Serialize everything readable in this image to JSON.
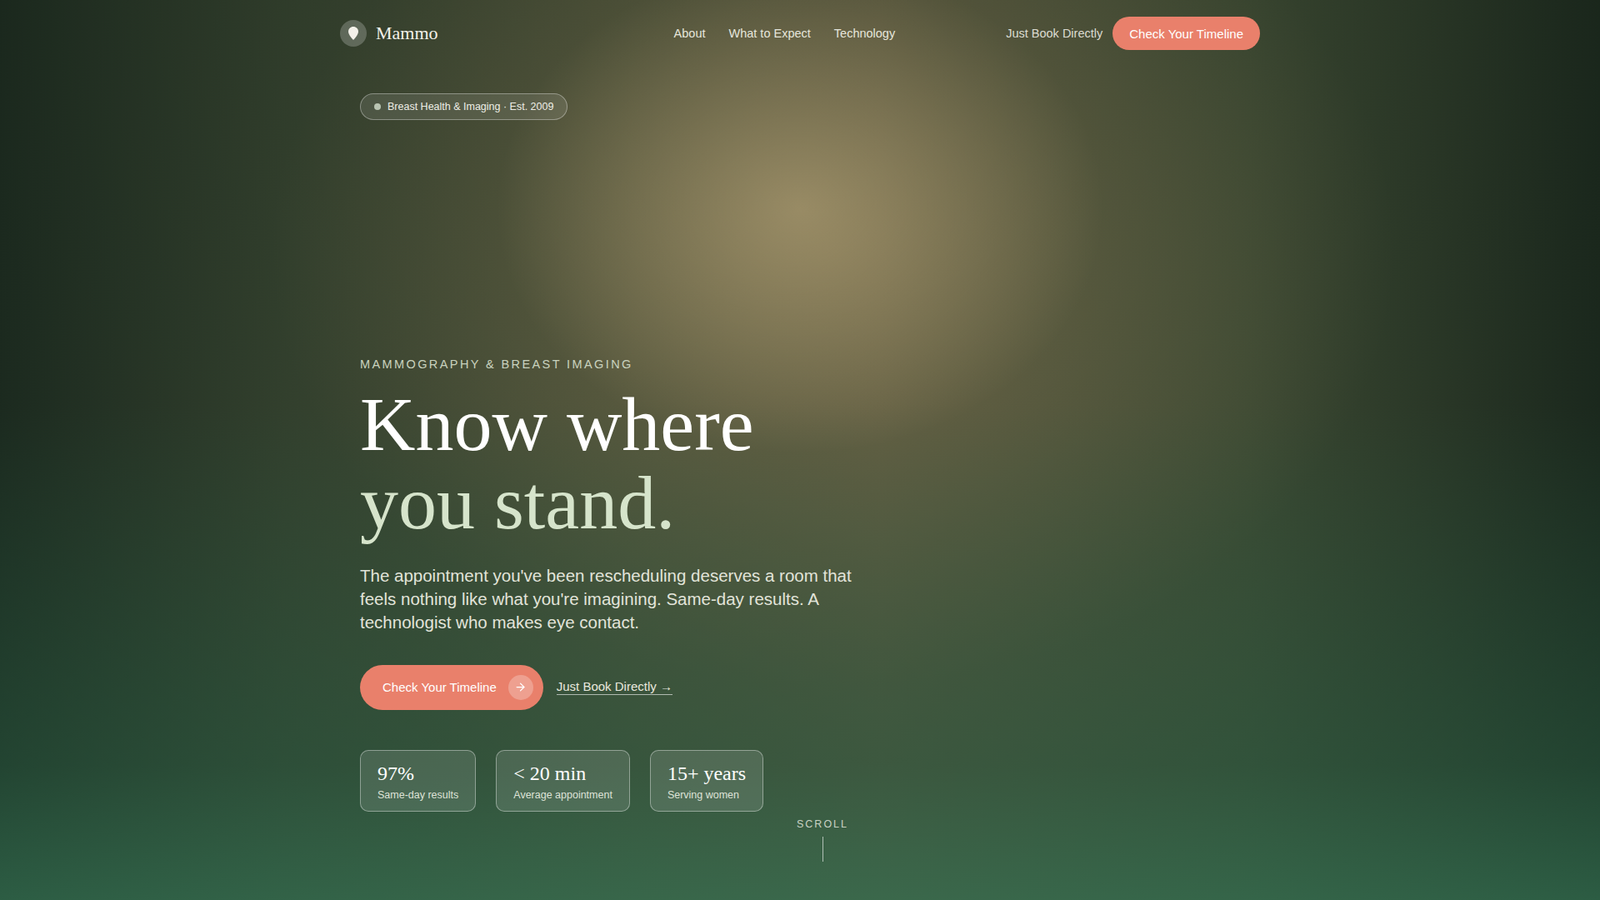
{
  "logo": {
    "name": "Mammo"
  },
  "nav": {
    "links": [
      "About",
      "What to Expect",
      "Technology"
    ],
    "secondary": "Just Book Directly",
    "primary": "Check Your Timeline"
  },
  "hero": {
    "badge": "Breast Health & Imaging · Est. 2009",
    "eyebrow": "MAMMOGRAPHY & BREAST IMAGING",
    "headline": [
      "Know where",
      "you stand."
    ],
    "body": "The appointment you've been rescheduling deserves a room that feels nothing like what you're imagining. Same-day results. A technologist who makes eye contact.",
    "primary_cta": "Check Your Timeline",
    "secondary_cta": "Just Book Directly →"
  },
  "stats": [
    {
      "value": "97%",
      "label": "Same-day results"
    },
    {
      "value": "< 20 min",
      "label": "Average appointment"
    },
    {
      "value": "15+ years",
      "label": "Serving women"
    }
  ],
  "scroll": "SCROLL"
}
